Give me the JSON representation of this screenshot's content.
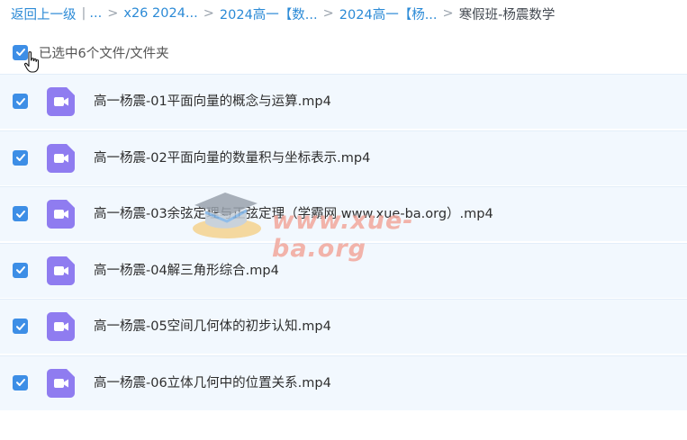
{
  "breadcrumb": {
    "back": "返回上一级",
    "ellipsis": "...",
    "items": [
      "x26 2024...",
      "2024高一【数...",
      "2024高一【杨..."
    ],
    "current": "寒假班-杨震数学"
  },
  "selection": {
    "label": "已选中6个文件/文件夹",
    "checked": true
  },
  "files": [
    {
      "name": "高一杨震-01平面向量的概念与运算.mp4",
      "checked": true
    },
    {
      "name": "高一杨震-02平面向量的数量积与坐标表示.mp4",
      "checked": true
    },
    {
      "name": "高一杨震-03余弦定理与正弦定理（学霸网 www.xue-ba.org）.mp4",
      "checked": true
    },
    {
      "name": "高一杨震-04解三角形综合.mp4",
      "checked": true
    },
    {
      "name": "高一杨震-05空间几何体的初步认知.mp4",
      "checked": true
    },
    {
      "name": "高一杨震-06立体几何中的位置关系.mp4",
      "checked": true
    }
  ],
  "watermark": {
    "text": "www.xue-ba.org"
  },
  "colors": {
    "link": "#2b8ad6",
    "checkbox": "#3d8ee6",
    "video_icon": "#8f7cf0",
    "row_bg": "#f2f8fe"
  },
  "icons": {
    "file": "video-file-icon",
    "check": "checkmark-icon",
    "cursor": "hand-pointer-icon"
  }
}
